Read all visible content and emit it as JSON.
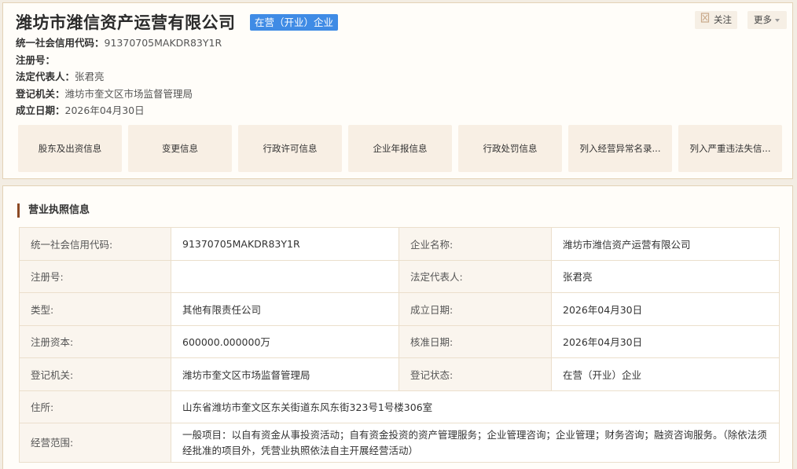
{
  "header": {
    "company_name": "潍坊市潍信资产运营有限公司",
    "status_badge": "在营（开业）企业",
    "follow_label": "关注",
    "more_label": "更多",
    "icons": {
      "follow": "bookmark-icon",
      "more": "caret-down-icon"
    }
  },
  "summary": [
    {
      "label": "统一社会信用代码：",
      "value": "91370705MAKDR83Y1R"
    },
    {
      "label": "注册号：",
      "value": ""
    },
    {
      "label": "法定代表人：",
      "value": "张君亮"
    },
    {
      "label": "登记机关：",
      "value": "潍坊市奎文区市场监督管理局"
    },
    {
      "label": "成立日期：",
      "value": "2026年04月30日"
    }
  ],
  "tabs": [
    "股东及出资信息",
    "变更信息",
    "行政许可信息",
    "企业年报信息",
    "行政处罚信息",
    "列入经营异常名录...",
    "列入严重违法失信..."
  ],
  "license": {
    "section_title": "营业执照信息",
    "rows": [
      {
        "k1": "统一社会信用代码:",
        "v1": "91370705MAKDR83Y1R",
        "k2": "企业名称:",
        "v2": "潍坊市潍信资产运营有限公司"
      },
      {
        "k1": "注册号:",
        "v1": "",
        "k2": "法定代表人:",
        "v2": "张君亮"
      },
      {
        "k1": "类型:",
        "v1": "其他有限责任公司",
        "k2": "成立日期:",
        "v2": "2026年04月30日"
      },
      {
        "k1": "注册资本:",
        "v1": "600000.000000万",
        "k2": "核准日期:",
        "v2": "2026年04月30日"
      },
      {
        "k1": "登记机关:",
        "v1": "潍坊市奎文区市场监督管理局",
        "k2": "登记状态:",
        "v2": "在营（开业）企业"
      }
    ],
    "address_label": "住所:",
    "address_value": "山东省潍坊市奎文区东关街道东风东街323号1号楼306室",
    "scope_label": "经营范围:",
    "scope_value": "一般项目：以自有资金从事投资活动；自有资金投资的资产管理服务；企业管理咨询；企业管理；财务咨询；融资咨询服务。（除依法须经批准的项目外，凭营业执照依法自主开展经营活动）"
  },
  "colors": {
    "badge_blue": "#3f8be5",
    "accent_brown": "#8c4a24",
    "card_border": "#e3d2b6",
    "tab_bg": "#f8efe4"
  }
}
